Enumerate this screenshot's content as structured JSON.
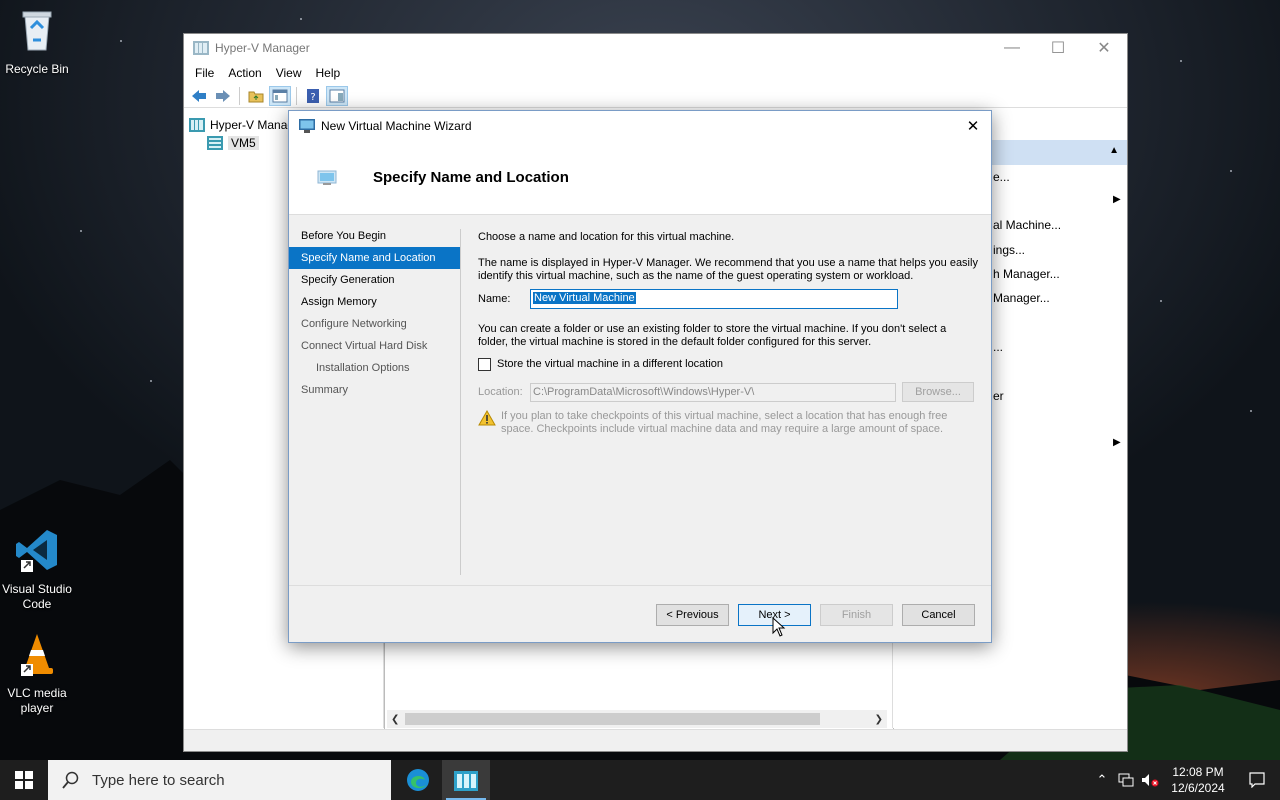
{
  "desktop": {
    "icons": [
      {
        "label": "Recycle Bin",
        "icon": "recycle-bin-icon"
      },
      {
        "label": "Visual Studio Code",
        "icon": "vscode-icon"
      },
      {
        "label": "VLC media player",
        "icon": "vlc-icon"
      }
    ]
  },
  "hyperv": {
    "title": "Hyper-V Manager",
    "menu": [
      "File",
      "Action",
      "View",
      "Help"
    ],
    "tree": {
      "root": "Hyper-V Manager",
      "child": "VM5"
    },
    "actions_partial": [
      "e...",
      "al Machine...",
      "ings...",
      "h Manager...",
      "Manager...",
      "...",
      "er"
    ]
  },
  "wizard": {
    "title": "New Virtual Machine Wizard",
    "heading": "Specify Name and Location",
    "nav": [
      {
        "label": "Before You Begin",
        "state": "normal"
      },
      {
        "label": "Specify Name and Location",
        "state": "active"
      },
      {
        "label": "Specify Generation",
        "state": "normal"
      },
      {
        "label": "Assign Memory",
        "state": "normal"
      },
      {
        "label": "Configure Networking",
        "state": "disabled"
      },
      {
        "label": "Connect Virtual Hard Disk",
        "state": "disabled"
      },
      {
        "label": "Installation Options",
        "state": "disabled-sub"
      },
      {
        "label": "Summary",
        "state": "disabled"
      }
    ],
    "intro": "Choose a name and location for this virtual machine.",
    "name_help": "The name is displayed in Hyper-V Manager. We recommend that you use a name that helps you easily identify this virtual machine, such as the name of the guest operating system or workload.",
    "name_label": "Name:",
    "name_value": "New Virtual Machine",
    "folder_help": "You can create a folder or use an existing folder to store the virtual machine. If you don't select a folder, the virtual machine is stored in the default folder configured for this server.",
    "store_checkbox": "Store the virtual machine in a different location",
    "store_checked": false,
    "location_label": "Location:",
    "location_value": "C:\\ProgramData\\Microsoft\\Windows\\Hyper-V\\",
    "browse_label": "Browse...",
    "warning": "If you plan to take checkpoints of this virtual machine, select a location that has enough free space. Checkpoints include virtual machine data and may require a large amount of space.",
    "buttons": {
      "previous": "< Previous",
      "next": "Next >",
      "finish": "Finish",
      "cancel": "Cancel"
    }
  },
  "taskbar": {
    "search_placeholder": "Type here to search",
    "time": "12:08 PM",
    "date": "12/6/2024"
  },
  "colors": {
    "accent": "#0a74c6",
    "taskbar": "#1e1e1e"
  }
}
